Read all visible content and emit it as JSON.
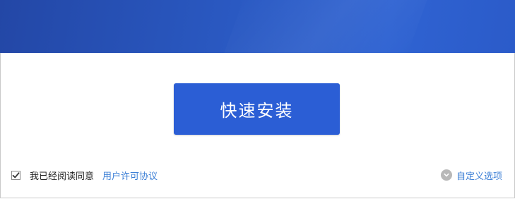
{
  "header": {
    "title_fragment": ""
  },
  "main": {
    "install_button_label": "快速安装"
  },
  "footer": {
    "agree_checked": true,
    "agree_text": "我已经阅读同意",
    "license_link": "用户许可协议",
    "custom_options_label": "自定义选项"
  },
  "colors": {
    "header_blue": "#2a59c2",
    "button_blue": "#2b5ed5",
    "link_blue": "#3c7fd6"
  },
  "icons": {
    "checkbox": "checkmark-icon",
    "custom_options": "chevron-down-circle-icon"
  }
}
